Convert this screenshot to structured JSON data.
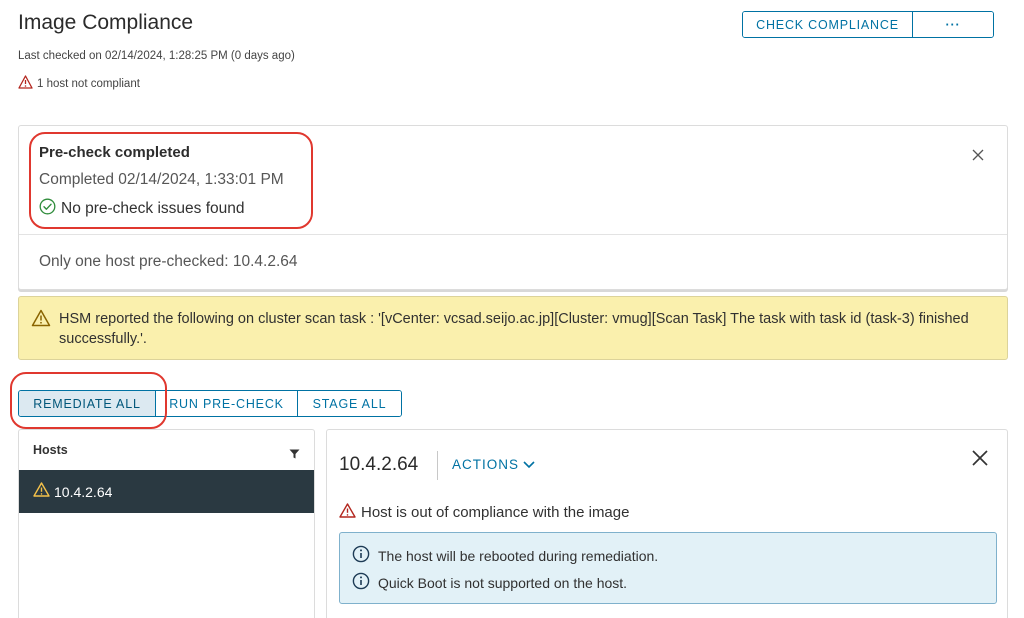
{
  "page": {
    "title": "Image Compliance",
    "last_checked": "Last checked on 02/14/2024, 1:28:25 PM (0 days ago)",
    "host_status": "1 host not compliant"
  },
  "header_buttons": {
    "check_compliance": "CHECK COMPLIANCE",
    "more": "···"
  },
  "precheck_card": {
    "title": "Pre-check completed",
    "completed": "Completed 02/14/2024, 1:33:01 PM",
    "result": "No pre-check issues found",
    "footer": "Only one host pre-checked: 10.4.2.64"
  },
  "alert": {
    "text": "HSM reported the following on cluster scan task : '[vCenter: vcsad.seijo.ac.jp][Cluster: vmug][Scan Task] The task with task id (task-3) finished successfully.'."
  },
  "action_bar": {
    "remediate_all": "REMEDIATE ALL",
    "run_precheck": "RUN PRE-CHECK",
    "stage_all": "STAGE ALL"
  },
  "hosts_panel": {
    "header": "Hosts",
    "hosts": [
      {
        "label": "10.4.2.64"
      }
    ]
  },
  "detail_panel": {
    "host": "10.4.2.64",
    "actions_label": "ACTIONS",
    "status": "Host is out of compliance with the image",
    "info": [
      "The host will be rebooted during remediation.",
      "Quick Boot is not supported on the host."
    ]
  },
  "colors": {
    "accent": "#0072a3",
    "warning_bg": "#faf0ad",
    "info_bg": "#e2f1f7",
    "selected_row": "#2a3941",
    "highlight_ring": "#e0382f",
    "success": "#2f8c3b",
    "danger": "#c92100"
  },
  "icons": {
    "host_status": "warning-triangle-icon",
    "result": "check-circle-icon",
    "alert": "warning-triangle-icon",
    "filter": "filter-icon",
    "close": "close-icon",
    "info": "info-circle-icon",
    "actions": "chevron-down-icon"
  }
}
